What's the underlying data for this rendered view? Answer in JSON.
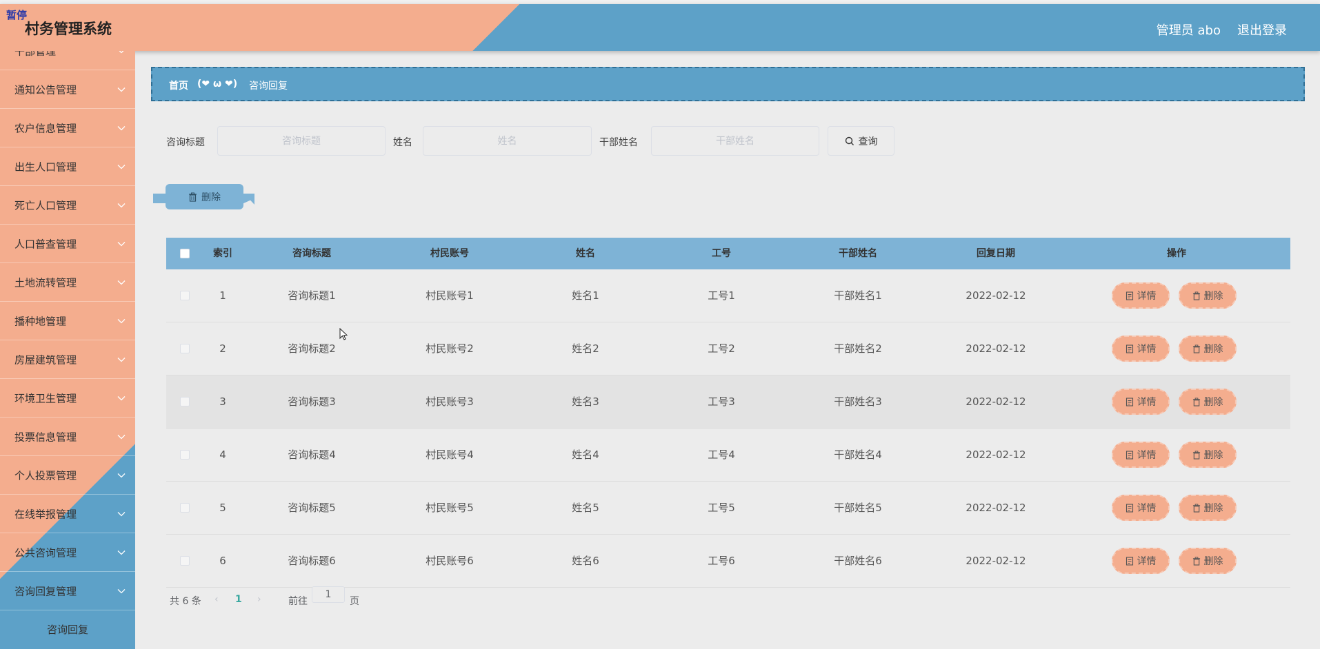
{
  "app": {
    "pause_badge": "暂停",
    "title": "村务管理系统",
    "user": "管理员 abo",
    "logout": "退出登录"
  },
  "sidebar": {
    "items": [
      {
        "label": "干部管理"
      },
      {
        "label": "通知公告管理"
      },
      {
        "label": "农户信息管理"
      },
      {
        "label": "出生人口管理"
      },
      {
        "label": "死亡人口管理"
      },
      {
        "label": "人口普查管理"
      },
      {
        "label": "土地流转管理"
      },
      {
        "label": "播种地管理"
      },
      {
        "label": "房屋建筑管理"
      },
      {
        "label": "环境卫生管理"
      },
      {
        "label": "投票信息管理"
      },
      {
        "label": "个人投票管理"
      },
      {
        "label": "在线举报管理"
      },
      {
        "label": "公共咨询管理"
      },
      {
        "label": "咨询回复管理"
      }
    ],
    "submenu": {
      "label": "咨询回复"
    }
  },
  "breadcrumb": {
    "home": "首页",
    "separator": "(❤ ω ❤)",
    "current": "咨询回复"
  },
  "search": {
    "title_label": "咨询标题",
    "title_placeholder": "咨询标题",
    "name_label": "姓名",
    "name_placeholder": "姓名",
    "cadre_label": "干部姓名",
    "cadre_placeholder": "干部姓名",
    "query_label": "查询"
  },
  "actions": {
    "delete_label": "删除"
  },
  "table": {
    "headers": [
      "索引",
      "咨询标题",
      "村民账号",
      "姓名",
      "工号",
      "干部姓名",
      "回复日期",
      "操作"
    ],
    "detail_label": "详情",
    "delete_label": "删除",
    "rows": [
      {
        "index": "1",
        "title": "咨询标题1",
        "account": "村民账号1",
        "name": "姓名1",
        "job_no": "工号1",
        "cadre": "干部姓名1",
        "date": "2022-02-12"
      },
      {
        "index": "2",
        "title": "咨询标题2",
        "account": "村民账号2",
        "name": "姓名2",
        "job_no": "工号2",
        "cadre": "干部姓名2",
        "date": "2022-02-12"
      },
      {
        "index": "3",
        "title": "咨询标题3",
        "account": "村民账号3",
        "name": "姓名3",
        "job_no": "工号3",
        "cadre": "干部姓名3",
        "date": "2022-02-12"
      },
      {
        "index": "4",
        "title": "咨询标题4",
        "account": "村民账号4",
        "name": "姓名4",
        "job_no": "工号4",
        "cadre": "干部姓名4",
        "date": "2022-02-12"
      },
      {
        "index": "5",
        "title": "咨询标题5",
        "account": "村民账号5",
        "name": "姓名5",
        "job_no": "工号5",
        "cadre": "干部姓名5",
        "date": "2022-02-12"
      },
      {
        "index": "6",
        "title": "咨询标题6",
        "account": "村民账号6",
        "name": "姓名6",
        "job_no": "工号6",
        "cadre": "干部姓名6",
        "date": "2022-02-12"
      }
    ]
  },
  "pagination": {
    "total": "共 6 条",
    "current_page": "1",
    "goto_label": "前往",
    "goto_value": "1",
    "page_suffix": "页"
  },
  "colors": {
    "salmon": "#f4ad8e",
    "blue": "#5da1c8",
    "header_blue": "#7eb3d6"
  }
}
